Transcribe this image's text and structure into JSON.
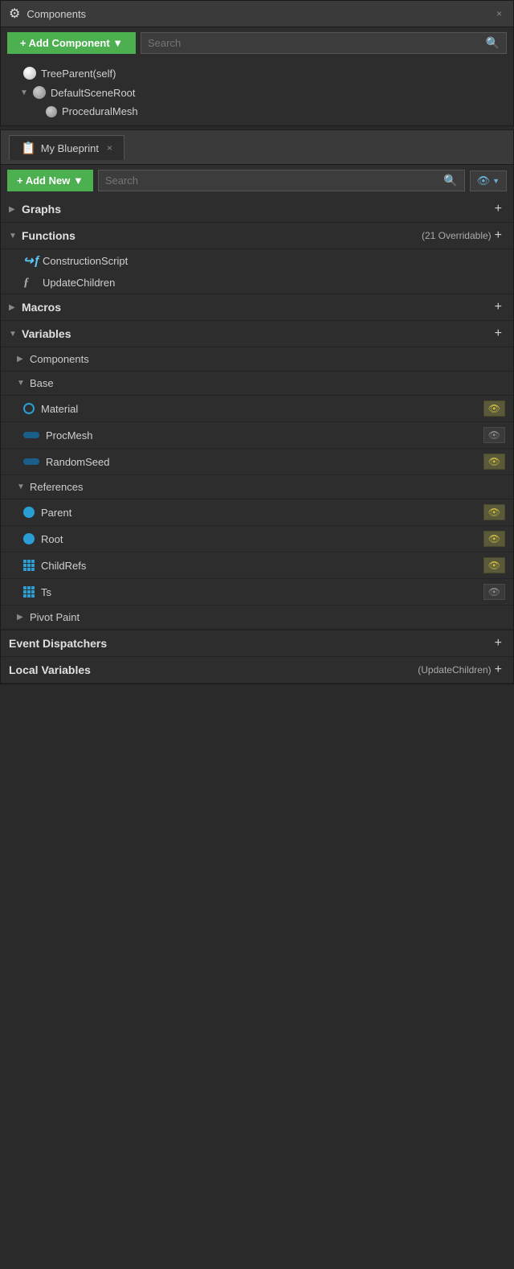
{
  "components_panel": {
    "title": "Components",
    "close_label": "×",
    "toolbar": {
      "add_button_label": "+ Add Component ▼",
      "search_placeholder": "Search"
    },
    "tree": [
      {
        "id": "tree-parent",
        "label": "TreeParent(self)",
        "indent": 0,
        "type": "sphere",
        "arrow": ""
      },
      {
        "id": "default-scene-root",
        "label": "DefaultSceneRoot",
        "indent": 1,
        "type": "sphere",
        "arrow": "▼"
      },
      {
        "id": "procedural-mesh",
        "label": "ProceduralMesh",
        "indent": 2,
        "type": "sphere-small",
        "arrow": ""
      }
    ]
  },
  "blueprint_panel": {
    "title": "My Blueprint",
    "close_label": "×",
    "toolbar": {
      "add_button_label": "+ Add New ▼",
      "search_placeholder": "Search",
      "eye_visible": true
    },
    "sections": {
      "graphs": {
        "label": "Graphs",
        "expanded": false,
        "arrow": "▶"
      },
      "functions": {
        "label": "Functions",
        "sublabel": "(21 Overridable)",
        "expanded": true,
        "arrow": "▼",
        "items": [
          {
            "label": "ConstructionScript",
            "type": "construction"
          },
          {
            "label": "UpdateChildren",
            "type": "function"
          }
        ]
      },
      "macros": {
        "label": "Macros",
        "expanded": false,
        "arrow": "▶"
      },
      "variables": {
        "label": "Variables",
        "expanded": true,
        "arrow": "▼",
        "categories": {
          "components": {
            "label": "Components",
            "expanded": false,
            "arrow": "▶"
          },
          "base": {
            "label": "Base",
            "expanded": true,
            "arrow": "▼",
            "items": [
              {
                "label": "Material",
                "type": "circle-outline",
                "color": "#2a9fd6",
                "eye": "yellow"
              },
              {
                "label": "ProcMesh",
                "type": "pill",
                "color": "#1a5f8a",
                "eye": "dark"
              },
              {
                "label": "RandomSeed",
                "type": "pill",
                "color": "#1a5f8a",
                "eye": "yellow"
              }
            ]
          },
          "references": {
            "label": "References",
            "expanded": true,
            "arrow": "▼",
            "items": [
              {
                "label": "Parent",
                "type": "circle",
                "color": "#2a9fd6",
                "eye": "yellow"
              },
              {
                "label": "Root",
                "type": "circle",
                "color": "#2a9fd6",
                "eye": "yellow"
              },
              {
                "label": "ChildRefs",
                "type": "grid",
                "color": "#2a9fd6",
                "eye": "yellow"
              },
              {
                "label": "Ts",
                "type": "grid",
                "color": "#2a9fd6",
                "eye": "dark"
              }
            ]
          },
          "pivot_paint": {
            "label": "Pivot Paint",
            "expanded": false,
            "arrow": "▶"
          }
        }
      }
    },
    "bottom_sections": [
      {
        "label": "Event Dispatchers",
        "has_add": true
      },
      {
        "label": "Local Variables",
        "sublabel": "(UpdateChildren)",
        "has_add": true
      }
    ]
  },
  "icons": {
    "plus": "+",
    "search": "🔍",
    "eye": "👁",
    "close": "×",
    "add": "+"
  }
}
